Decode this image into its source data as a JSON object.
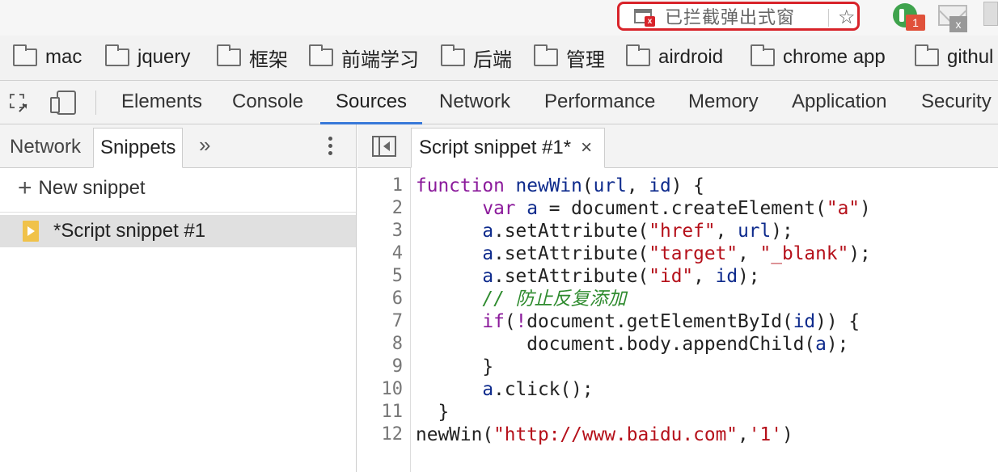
{
  "topbar": {
    "popup_blocked_label": "已拦截弹出式窗",
    "extension_badge": "1",
    "mail_badge": "x"
  },
  "bookmarks": [
    "mac",
    "jquery",
    "框架",
    "前端学习",
    "后端",
    "管理",
    "airdroid",
    "chrome app",
    "githul"
  ],
  "devtools": {
    "tabs": [
      "Elements",
      "Console",
      "Sources",
      "Network",
      "Performance",
      "Memory",
      "Application",
      "Security"
    ],
    "active_tab": "Sources",
    "accent_color": "#3879d9"
  },
  "navigator": {
    "tabs": [
      "Network",
      "Snippets"
    ],
    "active_tab": "Snippets",
    "more_label": "»",
    "new_snippet_label": "New snippet",
    "snippets": [
      "*Script snippet #1"
    ]
  },
  "editor": {
    "tab_label": "Script snippet #1*",
    "line_numbers": [
      "1",
      "2",
      "3",
      "4",
      "5",
      "6",
      "7",
      "8",
      "9",
      "10",
      "11",
      "12"
    ],
    "code_lines": [
      [
        [
          "kw",
          "function "
        ],
        [
          "fn",
          "newWin"
        ],
        [
          "pl",
          "("
        ],
        [
          "fn",
          "url"
        ],
        [
          "pl",
          ", "
        ],
        [
          "fn",
          "id"
        ],
        [
          "pl",
          ") {"
        ]
      ],
      [
        [
          "pl",
          "      "
        ],
        [
          "kw",
          "var "
        ],
        [
          "fn",
          "a"
        ],
        [
          "pl",
          " = document.createElement("
        ],
        [
          "str",
          "\"a\""
        ],
        [
          "pl",
          ")"
        ]
      ],
      [
        [
          "pl",
          "      "
        ],
        [
          "fn",
          "a"
        ],
        [
          "pl",
          ".setAttribute("
        ],
        [
          "str",
          "\"href\""
        ],
        [
          "pl",
          ", "
        ],
        [
          "fn",
          "url"
        ],
        [
          "pl",
          ");"
        ]
      ],
      [
        [
          "pl",
          "      "
        ],
        [
          "fn",
          "a"
        ],
        [
          "pl",
          ".setAttribute("
        ],
        [
          "str",
          "\"target\""
        ],
        [
          "pl",
          ", "
        ],
        [
          "str",
          "\"_blank\""
        ],
        [
          "pl",
          ");"
        ]
      ],
      [
        [
          "pl",
          "      "
        ],
        [
          "fn",
          "a"
        ],
        [
          "pl",
          ".setAttribute("
        ],
        [
          "str",
          "\"id\""
        ],
        [
          "pl",
          ", "
        ],
        [
          "fn",
          "id"
        ],
        [
          "pl",
          ");"
        ]
      ],
      [
        [
          "pl",
          "      "
        ],
        [
          "cm",
          "// 防止反复添加"
        ]
      ],
      [
        [
          "pl",
          "      "
        ],
        [
          "kw",
          "if"
        ],
        [
          "pl",
          "("
        ],
        [
          "kw",
          "!"
        ],
        [
          "pl",
          "document.getElementById("
        ],
        [
          "fn",
          "id"
        ],
        [
          "pl",
          ")) {"
        ]
      ],
      [
        [
          "pl",
          "          document.body.appendChild("
        ],
        [
          "fn",
          "a"
        ],
        [
          "pl",
          ");"
        ]
      ],
      [
        [
          "pl",
          "      }"
        ]
      ],
      [
        [
          "pl",
          "      "
        ],
        [
          "fn",
          "a"
        ],
        [
          "pl",
          ".click();"
        ]
      ],
      [
        [
          "pl",
          "  }"
        ]
      ],
      [
        [
          "pl",
          "newWin("
        ],
        [
          "str",
          "\"http://www.baidu.com\""
        ],
        [
          "pl",
          ","
        ],
        [
          "str",
          "'1'"
        ],
        [
          "pl",
          ")"
        ]
      ]
    ]
  }
}
